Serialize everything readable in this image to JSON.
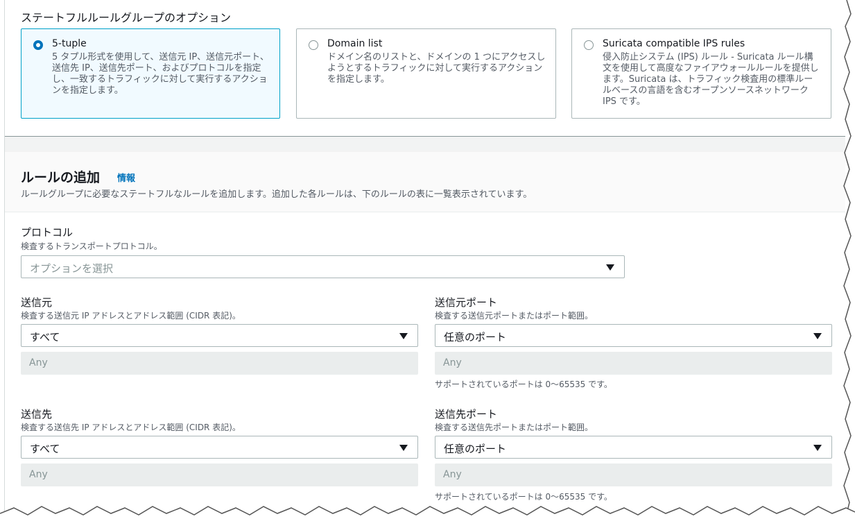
{
  "stateful_options": {
    "title": "ステートフルルールグループのオプション",
    "cards": [
      {
        "label": "5-tuple",
        "selected": true,
        "description": "5 タプル形式を使用して、送信元 IP、送信元ポート、送信先 IP、送信先ポート、およびプロトコルを指定し、一致するトラフィックに対して実行するアクションを指定します。"
      },
      {
        "label": "Domain list",
        "selected": false,
        "description": "ドメイン名のリストと、ドメインの 1 つにアクセスしようとするトラフィックに対して実行するアクションを指定します。"
      },
      {
        "label": "Suricata compatible IPS rules",
        "selected": false,
        "description": "侵入防止システム (IPS) ルール - Suricata ルール構文を使用して高度なファイアウォールルールを提供します。Suricata は、トラフィック検査用の標準ルールベースの言語を含むオープンソースネットワーク IPS です。"
      }
    ]
  },
  "add_rule": {
    "title": "ルールの追加",
    "info_link": "情報",
    "description": "ルールグループに必要なステートフルなルールを追加します。追加した各ルールは、下のルールの表に一覧表示されています。"
  },
  "protocol": {
    "label": "プロトコル",
    "description": "検査するトランスポートプロトコル。",
    "placeholder": "オプションを選択"
  },
  "source": {
    "label": "送信元",
    "description": "検査する送信元 IP アドレスとアドレス範囲 (CIDR 表記)。",
    "value": "すべて",
    "input_value": "Any"
  },
  "source_port": {
    "label": "送信元ポート",
    "description": "検査する送信元ポートまたはポート範囲。",
    "value": "任意のポート",
    "input_value": "Any",
    "hint": "サポートされているポートは 0～65535 です。"
  },
  "destination": {
    "label": "送信先",
    "description": "検査する送信先 IP アドレスとアドレス範囲 (CIDR 表記)。",
    "value": "すべて",
    "input_value": "Any"
  },
  "destination_port": {
    "label": "送信先ポート",
    "description": "検査する送信先ポートまたはポート範囲。",
    "value": "任意のポート",
    "input_value": "Any",
    "hint": "サポートされているポートは 0～65535 です。"
  },
  "colors": {
    "selected_border": "#00a1c9",
    "selected_bg": "#f1faff",
    "link": "#0073bb",
    "radio_checked": "#0073bb"
  }
}
